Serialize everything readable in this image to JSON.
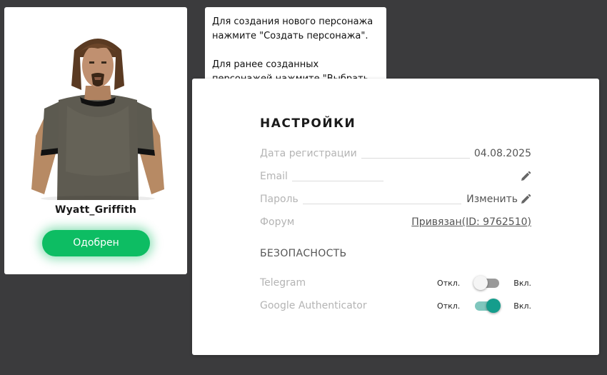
{
  "character": {
    "name": "Wyatt_Griffith",
    "status_label": "Одобрен",
    "status_color": "#0dbd63"
  },
  "info": {
    "paragraph1": "Для создания нового персонажа нажмите \"Создать персонажа\".",
    "paragraph2": "Для ранее созданных персонажей нажмите \"Выбрать персонажа\"."
  },
  "settings": {
    "title": "НАСТРОЙКИ",
    "registration": {
      "label": "Дата регистрации",
      "value": "04.08.2025"
    },
    "email": {
      "label": "Email",
      "edit_icon": "pencil-icon"
    },
    "password": {
      "label": "Пароль",
      "action": "Изменить",
      "edit_icon": "pencil-icon"
    },
    "forum": {
      "label": "Форум",
      "link": "Привязан(ID: 9762510)"
    },
    "security": {
      "title": "БЕЗОПАСНОСТЬ",
      "off_label": "Откл.",
      "on_label": "Вкл.",
      "accent_color": "#159d8c",
      "items": [
        {
          "label": "Telegram",
          "enabled": false
        },
        {
          "label": "Google Authenticator",
          "enabled": true
        }
      ]
    }
  }
}
